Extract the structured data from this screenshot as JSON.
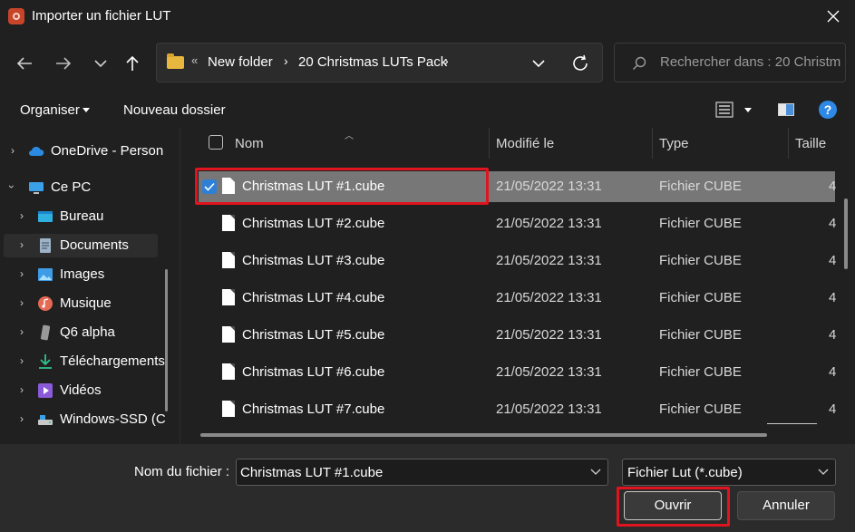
{
  "window": {
    "title": "Importer un fichier LUT"
  },
  "address": {
    "crumbs": [
      "New folder",
      "20 Christmas LUTs Pack"
    ]
  },
  "search": {
    "placeholder": "Rechercher dans : 20 Christm..."
  },
  "toolbar": {
    "organiser_label": "Organiser",
    "new_folder_label": "Nouveau dossier"
  },
  "sidebar": {
    "items": [
      {
        "label": "OneDrive - Person",
        "icon": "cloud-icon"
      },
      {
        "label": "Ce PC",
        "icon": "computer-icon"
      },
      {
        "label": "Bureau",
        "icon": "desktop-icon"
      },
      {
        "label": "Documents",
        "icon": "documents-icon"
      },
      {
        "label": "Images",
        "icon": "images-icon"
      },
      {
        "label": "Musique",
        "icon": "music-icon"
      },
      {
        "label": "Q6 alpha",
        "icon": "phone-icon"
      },
      {
        "label": "Téléchargements",
        "icon": "download-icon"
      },
      {
        "label": "Vidéos",
        "icon": "videos-icon"
      },
      {
        "label": "Windows-SSD (C",
        "icon": "drive-icon"
      }
    ],
    "selected": "Documents"
  },
  "columns": {
    "name": "Nom",
    "modified": "Modifié le",
    "type": "Type",
    "size": "Taille"
  },
  "files": [
    {
      "name": "Christmas LUT #1.cube",
      "modified": "21/05/2022 13:31",
      "type": "Fichier CUBE",
      "size": "4",
      "selected": true
    },
    {
      "name": "Christmas LUT #2.cube",
      "modified": "21/05/2022 13:31",
      "type": "Fichier CUBE",
      "size": "4"
    },
    {
      "name": "Christmas LUT #3.cube",
      "modified": "21/05/2022 13:31",
      "type": "Fichier CUBE",
      "size": "4"
    },
    {
      "name": "Christmas LUT #4.cube",
      "modified": "21/05/2022 13:31",
      "type": "Fichier CUBE",
      "size": "4"
    },
    {
      "name": "Christmas LUT #5.cube",
      "modified": "21/05/2022 13:31",
      "type": "Fichier CUBE",
      "size": "4"
    },
    {
      "name": "Christmas LUT #6.cube",
      "modified": "21/05/2022 13:31",
      "type": "Fichier CUBE",
      "size": "4"
    },
    {
      "name": "Christmas LUT #7.cube",
      "modified": "21/05/2022 13:31",
      "type": "Fichier CUBE",
      "size": "4"
    }
  ],
  "footer": {
    "filename_label": "Nom du fichier :",
    "filename_value": "Christmas LUT #1.cube",
    "filetype_value": "Fichier Lut (*.cube)",
    "open_label": "Ouvrir",
    "cancel_label": "Annuler"
  },
  "colors": {
    "background": "#202020",
    "selection": "#777777",
    "highlight_red": "#e0141e",
    "accent_blue": "#2e7fd6"
  }
}
